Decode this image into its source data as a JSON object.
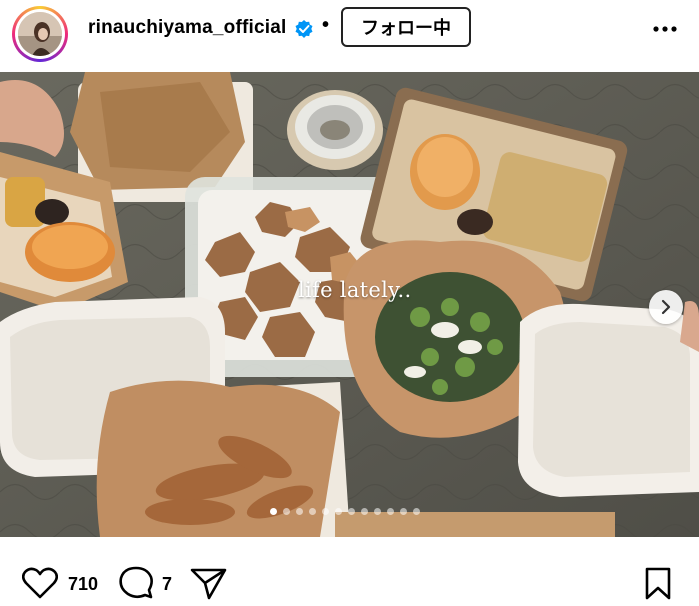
{
  "header": {
    "username": "rinauchiyama_official",
    "separator": "•",
    "follow_label": "フォロー中"
  },
  "post": {
    "overlay_text": "life lately..",
    "carousel": {
      "total": 12,
      "active_index": 0
    }
  },
  "actions": {
    "like_count": "710",
    "comment_count": "7"
  },
  "icons": [
    "verified-badge-icon",
    "more-options-icon",
    "next-arrow-icon",
    "heart-icon",
    "comment-icon",
    "share-icon",
    "bookmark-icon"
  ],
  "colors": {
    "verified": "#0095f6",
    "text": "#000000"
  }
}
